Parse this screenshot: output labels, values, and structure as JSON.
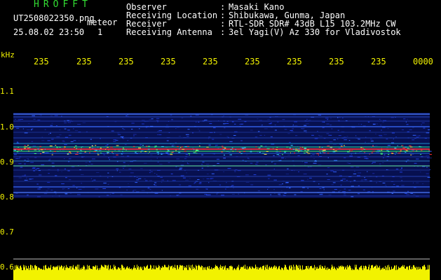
{
  "header": {
    "app_title": "HROFFT",
    "file_name": "UT2508022350.png",
    "event_type": "meteor",
    "timestamp": "25.08.02 23:50",
    "event_count": "1"
  },
  "station_info": [
    {
      "label": "Observer",
      "value": "Masaki Kano"
    },
    {
      "label": "Receiving Location",
      "value": "Shibukawa, Gunma, Japan"
    },
    {
      "label": "Receiver",
      "value": "RTL-SDR SDR# 43dB L15 103.2MHz CW"
    },
    {
      "label": "Receiving Antenna",
      "value": "3el Yagi(V) Az 330 for Vladivostok"
    }
  ],
  "axis": {
    "freq_unit": "kHz",
    "freq_ticks": [
      "1.1",
      "1.0",
      "0.9",
      "0.8",
      "0.7",
      "0.6"
    ],
    "time_ticks": [
      "235",
      "235",
      "235",
      "235",
      "235",
      "235",
      "235",
      "235",
      "235",
      "0000"
    ]
  },
  "colors": {
    "background": "#000000",
    "label_text": "#ffffff",
    "title_text": "#33dd33",
    "axis_text": "#f2f200",
    "noise_bar": "#f2f200",
    "spectrum_low": "#1020a0",
    "spectrum_high": "#ff3030"
  }
}
